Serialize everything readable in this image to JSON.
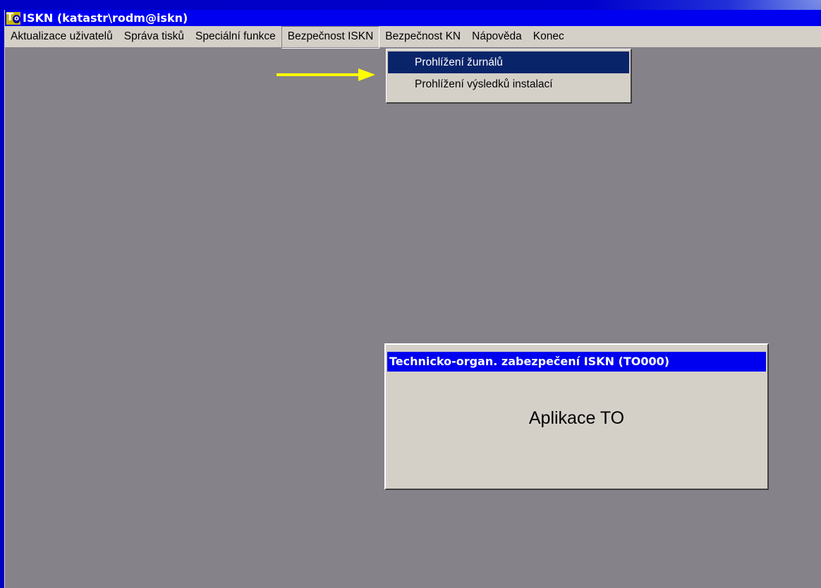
{
  "window": {
    "title": "ISKN (katastr\\rodm@iskn)",
    "icon": "to-app-icon",
    "icon_letters": [
      "T",
      "o"
    ]
  },
  "menubar": {
    "items": [
      {
        "label": "Aktualizace uživatelů"
      },
      {
        "label": "Správa tisků"
      },
      {
        "label": "Speciální funkce"
      },
      {
        "label": "Bezpečnost ISKN",
        "active": true
      },
      {
        "label": "Bezpečnost KN"
      },
      {
        "label": "Nápověda"
      },
      {
        "label": "Konec"
      }
    ]
  },
  "dropdown": {
    "items": [
      {
        "label": "Prohlížení žurnálů",
        "selected": true
      },
      {
        "label": "Prohlížení výsledků instalací"
      }
    ]
  },
  "annotation": {
    "icon": "yellow-arrow-icon",
    "color": "#ffff00"
  },
  "dialog": {
    "title": "Technicko-organ. zabezpečení ISKN (TO000)",
    "body": "Aplikace TO"
  },
  "colors": {
    "titlebar": "#0000f0",
    "menu_selected": "#0a246a",
    "workspace": "#858289",
    "chrome": "#d4d0c8"
  }
}
